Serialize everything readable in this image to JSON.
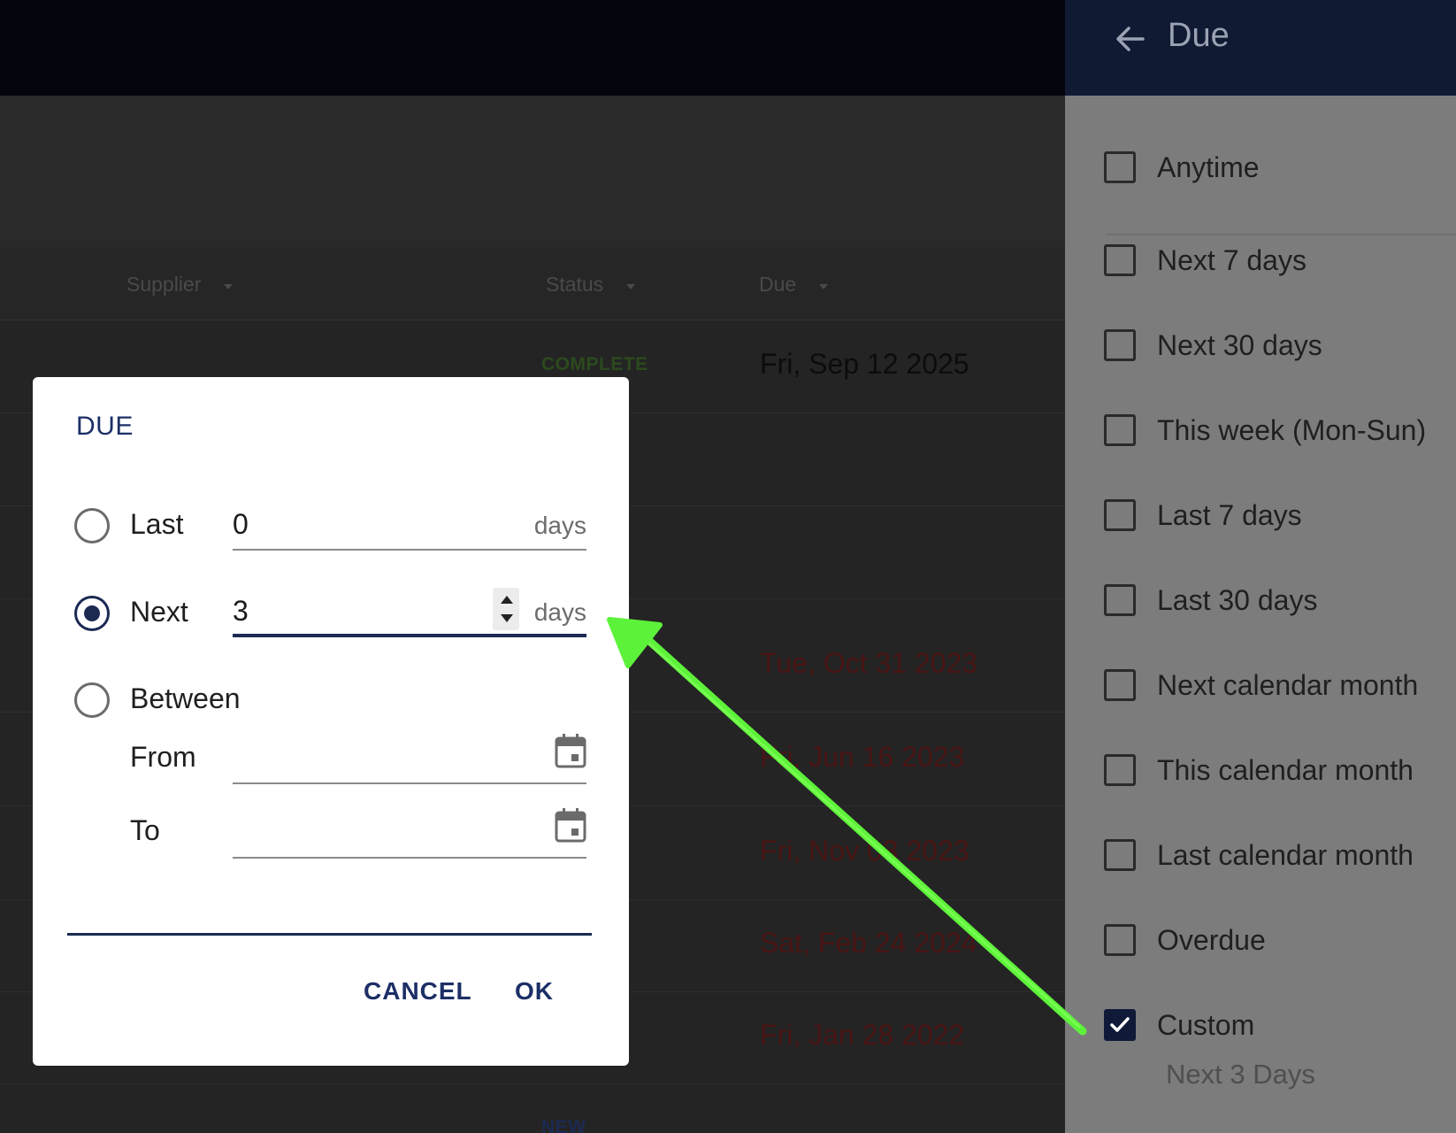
{
  "table": {
    "headers": {
      "supplier": "Supplier",
      "status": "Status",
      "due": "Due"
    },
    "rows": [
      {
        "status": "COMPLETE",
        "status_color": "#2c4a1e",
        "due": "Fri, Sep 12 2025",
        "due_color": "#0c0c0c"
      },
      {
        "status": "",
        "status_color": "#2c4a1e",
        "due": "",
        "due_color": "#4a1515"
      },
      {
        "status": "",
        "status_color": "#2c4a1e",
        "due": "",
        "due_color": "#4a1515"
      },
      {
        "status": "",
        "status_color": "#3a2d12",
        "due": "Tue, Oct 31 2023",
        "due_color": "#4a1515"
      },
      {
        "status": "",
        "status_color": "#3a2d12",
        "due": "Fri, Jun 16 2023",
        "due_color": "#4a1515"
      },
      {
        "status": "",
        "status_color": "#3a2d12",
        "due": "Fri, Nov 03 2023",
        "due_color": "#4a1515"
      },
      {
        "status": "",
        "status_color": "#3a2d12",
        "due": "Sat, Feb 24 2024",
        "due_color": "#4a1515"
      },
      {
        "status": "",
        "status_color": "#2c4a1e",
        "due": "Fri, Jan 28 2022",
        "due_color": "#4a1515"
      },
      {
        "status": "NEW",
        "status_color": "#1c2a52",
        "due": "",
        "due_color": "#4a1515"
      }
    ]
  },
  "panel": {
    "title": "Due",
    "options": [
      {
        "label": "Anytime",
        "checked": false
      },
      {
        "label": "Next 7 days",
        "checked": false
      },
      {
        "label": "Next 30 days",
        "checked": false
      },
      {
        "label": "This week (Mon-Sun)",
        "checked": false
      },
      {
        "label": "Last 7 days",
        "checked": false
      },
      {
        "label": "Last 30 days",
        "checked": false
      },
      {
        "label": "Next calendar month",
        "checked": false
      },
      {
        "label": "This calendar month",
        "checked": false
      },
      {
        "label": "Last calendar month",
        "checked": false
      },
      {
        "label": "Overdue",
        "checked": false
      },
      {
        "label": "Custom",
        "checked": true
      }
    ],
    "custom_summary": "Next 3 Days"
  },
  "dialog": {
    "title": "DUE",
    "last": {
      "label": "Last",
      "value": "0",
      "suffix": "days",
      "selected": false
    },
    "next": {
      "label": "Next",
      "value": "3",
      "suffix": "days",
      "selected": true
    },
    "between": {
      "label": "Between",
      "selected": false
    },
    "from": {
      "label": "From",
      "value": ""
    },
    "to": {
      "label": "To",
      "value": ""
    },
    "cancel_label": "CANCEL",
    "ok_label": "OK"
  },
  "colors": {
    "accent": "#1c2a52",
    "panel_header": "#111a33",
    "annotation_arrow": "#5df23a"
  },
  "icons": {
    "back": "arrow-left-icon",
    "calendar": "calendar-icon",
    "check": "check-icon",
    "sort": "caret-down-icon"
  }
}
